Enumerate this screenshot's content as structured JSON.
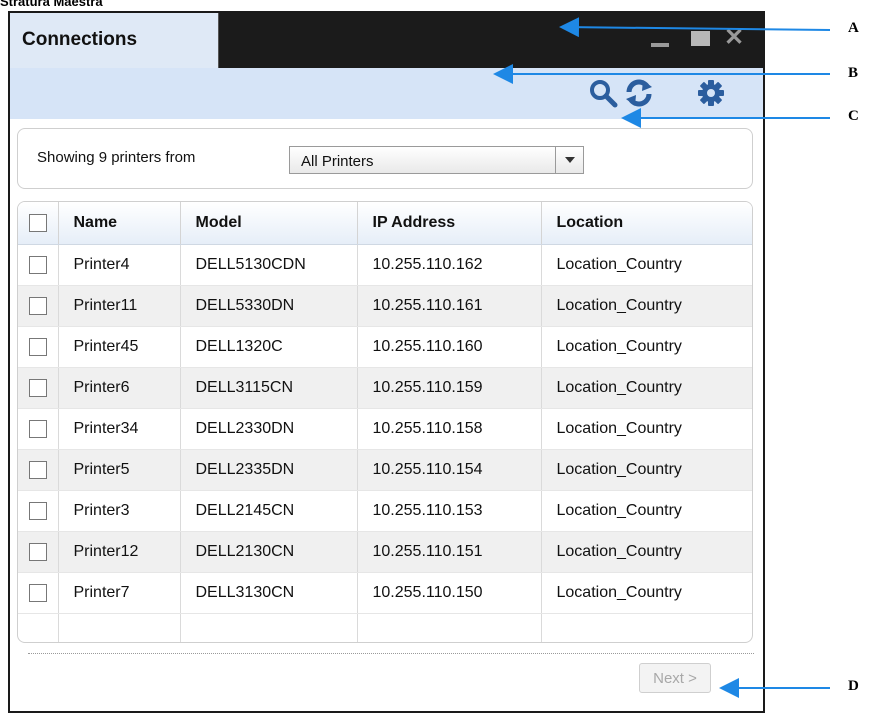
{
  "caption": "Stratura Maestra",
  "window": {
    "title": "Connections",
    "controls": {
      "minimize": "minimize-icon",
      "maximize": "maximize-icon",
      "close": "close-icon"
    }
  },
  "toolbar": {
    "icons": [
      "search-icon",
      "refresh-icon",
      "gear-icon"
    ]
  },
  "filter": {
    "label": "Showing 9 printers from",
    "selected": "All Printers"
  },
  "table": {
    "columns": [
      "Name",
      "Model",
      "IP Address",
      "Location"
    ],
    "rows": [
      [
        "Printer4",
        "DELL5130CDN",
        "10.255.110.162",
        "Location_Country"
      ],
      [
        "Printer11",
        "DELL5330DN",
        "10.255.110.161",
        "Location_Country"
      ],
      [
        "Printer45",
        "DELL1320C",
        "10.255.110.160",
        "Location_Country"
      ],
      [
        "Printer6",
        "DELL3115CN",
        "10.255.110.159",
        "Location_Country"
      ],
      [
        "Printer34",
        "DELL2330DN",
        "10.255.110.158",
        "Location_Country"
      ],
      [
        "Printer5",
        "DELL2335DN",
        "10.255.110.154",
        "Location_Country"
      ],
      [
        "Printer3",
        "DELL2145CN",
        "10.255.110.153",
        "Location_Country"
      ],
      [
        "Printer12",
        "DELL2130CN",
        "10.255.110.151",
        "Location_Country"
      ],
      [
        "Printer7",
        "DELL3130CN",
        "10.255.110.150",
        "Location_Country"
      ]
    ]
  },
  "pagination": {
    "next_label": "Next >"
  },
  "callouts": [
    "A",
    "B",
    "C",
    "D"
  ],
  "colors": {
    "accent": "#1e88e5",
    "titlebar": "#1b1b1b",
    "tab": "#dfe9f6",
    "toolbar": "#d6e4f7",
    "icon": "#2b5d9e"
  }
}
